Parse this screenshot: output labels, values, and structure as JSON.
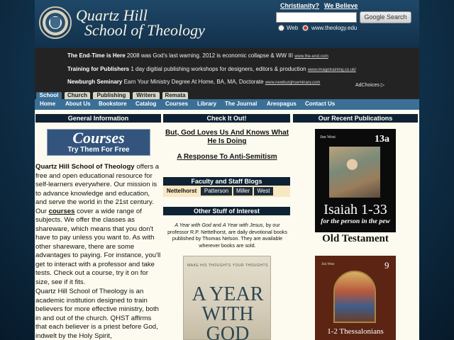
{
  "header": {
    "logo_line1": "Quartz Hill",
    "logo_line2": "School of Theology",
    "links": [
      "Christianity?",
      "We Believe"
    ],
    "search_placeholder": "",
    "search_button": "Google Search",
    "radio_web": "Web",
    "radio_site": "www.theology.edu",
    "selected_radio": "www.theology.edu"
  },
  "ads": [
    {
      "title": "The End-Time is Here",
      "text": "2008 was God's last warning. 2012 is economic collapse & WW III",
      "url": "www.the-end.com"
    },
    {
      "title": "Training for Publishers",
      "text": "1 day digitial publishing workshops for designers, editors & production",
      "url": "www.imagotraining.co.uk/"
    },
    {
      "title": "Newburgh Seminary",
      "text": "Earn Your Ministry Degree At Home, BA, MA, Doctorate",
      "url": "www.newburghseminary.com"
    }
  ],
  "adchoices": "AdChoices ▷",
  "tabs": [
    {
      "label": "School",
      "active": true
    },
    {
      "label": "Church",
      "active": false
    },
    {
      "label": "Publishing",
      "active": false
    },
    {
      "label": "Writers",
      "active": false
    },
    {
      "label": "Remata",
      "active": false
    }
  ],
  "nav": [
    "Home",
    "About Us",
    "Bookstore",
    "Catalog",
    "Courses",
    "Library",
    "The Journal",
    "Areopagus",
    "Contact Us"
  ],
  "left": {
    "heading": "General Information",
    "banner_title": "Courses",
    "banner_subtitle": "Try Them For Free",
    "para1_strong": "Quartz Hill School of Theology",
    "para1_a": " offers a free and open educational resource for self-learners everywhere. Our mission is to advance knowledge and education, and serve the world in the 21st century. Our ",
    "para1_link": "courses",
    "para1_b": " cover a wide range of subjects. We offer the classes as shareware, which means that you don't have to pay unless you want to. As with other shareware, there are some advantages to paying. For instance, you'll get to interact with a professor and take tests. Check out a course, try it on for size, see if it fits.",
    "para2": "Quartz Hill School of Theology is an academic institution designed to train believers for more effective ministry, both in and out of the church. QHST affirms that each believer is a priest before God, indwelt by the Holy Spirit,"
  },
  "middle": {
    "heading": "Check It Out!",
    "link1": "But, God Loves Us And Knows What He Is Doing",
    "link2": "A Response To Anti-Semitism",
    "blogs_heading": "Faculty and Staff Blogs",
    "blog_owner": "Nettelhorst",
    "blog_buttons": [
      "Patterson",
      "Miller",
      "West"
    ],
    "other_heading": "Other Stuff of Interest",
    "books_title1": "A Year with God",
    "books_and": " and ",
    "books_title2": "A Year with Jesus",
    "books_text": ", by our professor R.P. Nettelhorst, are daily devotional books published by Thomas Nelson. They are available wherever books are sold.",
    "cover_tagline": "MAKE HIS THOUGHTS YOUR THOUGHTS",
    "cover_title": "A YEAR WITH GOD"
  },
  "right": {
    "heading": "Our Recent Publications",
    "pub1": {
      "author": "Jim West",
      "number": "13a",
      "title": "Isaiah 1-33",
      "subtitle": "for the person in the pew"
    },
    "testament": "Old Testament",
    "pub2": {
      "author": "Jim West",
      "number": "9",
      "title": "1-2 Thessalonians"
    }
  },
  "colors": {
    "header_bg": "#173a57",
    "ad_bg": "#232323",
    "nav_bg": "#3b6f96",
    "column_head_bg": "#0e2233",
    "page_bg": "#fdfbf0",
    "radio_selected": "#c0392b"
  }
}
